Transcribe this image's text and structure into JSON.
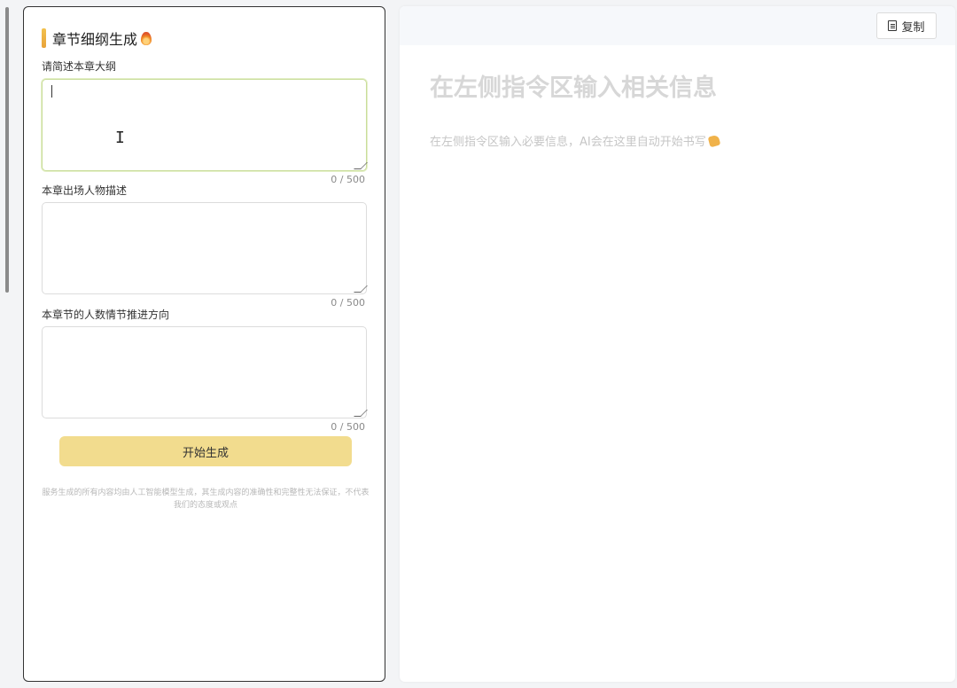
{
  "left": {
    "title": "章节细纲生成",
    "title_icon": "fire-icon",
    "fields": [
      {
        "label": "请简述本章大纲",
        "value": "",
        "counter": "0 / 500"
      },
      {
        "label": "本章出场人物描述",
        "value": "",
        "counter": "0 / 500"
      },
      {
        "label": "本章节的人数情节推进方向",
        "value": "",
        "counter": "0 / 500"
      }
    ],
    "generate_label": "开始生成",
    "disclaimer": "服务生成的所有内容均由人工智能模型生成，其生成内容的准确性和完整性无法保证，不代表我们的态度或观点"
  },
  "right": {
    "copy_label": "复制",
    "copy_icon": "document-icon",
    "placeholder_title": "在左侧指令区输入相关信息",
    "placeholder_text": "在左侧指令区输入必要信息，AI会在这里自动开始书写",
    "placeholder_icon": "writing-hand-icon"
  },
  "colors": {
    "accent": "#f2dc8e",
    "title_bar": "#e8a33a"
  }
}
